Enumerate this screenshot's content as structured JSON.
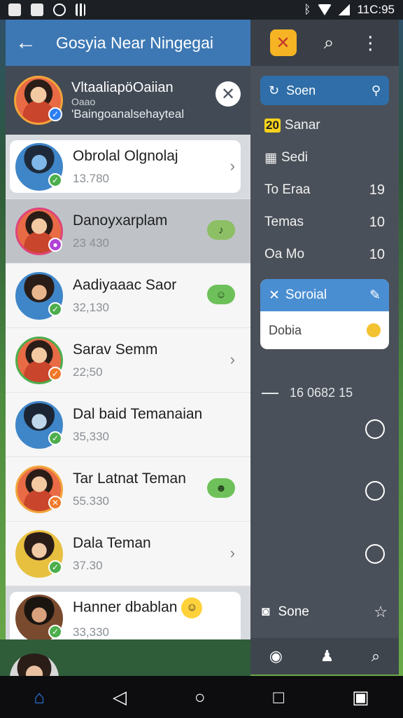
{
  "status_bar": {
    "time": "11C:95"
  },
  "app_bar": {
    "title": "Gosyia Near Ningegai"
  },
  "selected": {
    "name": "VltaaliapöOaiian",
    "line1": "Oaao",
    "line2": "'Baingoanalsehayteal"
  },
  "contacts": [
    {
      "name": "Obrolal Olgnolaj",
      "meta": "13.780"
    },
    {
      "name": "Danoyxarplam",
      "meta": "23 430"
    },
    {
      "name": "Aadiyaaac Saor",
      "meta": "32,130"
    },
    {
      "name": "Sarav Semm",
      "meta": "22;50"
    },
    {
      "name": "Dal baid Temanaian",
      "meta": "35,330"
    },
    {
      "name": "Tar Latnat Teman",
      "meta": "55.330"
    },
    {
      "name": "Dala Teman",
      "meta": "37.30"
    },
    {
      "name": "Hanner dbablan",
      "meta": "33,330"
    }
  ],
  "drawer": {
    "search_label": "Soen",
    "items": [
      {
        "tag": "20",
        "label": "Sanar",
        "num": ""
      },
      {
        "tag": "",
        "label": "Sedi",
        "num": ""
      },
      {
        "tag": "",
        "label": "To Eraa",
        "num": "19"
      },
      {
        "tag": "",
        "label": "Temas",
        "num": "10"
      },
      {
        "tag": "",
        "label": "Oa Mo",
        "num": "10"
      }
    ],
    "social_title": "Soroial",
    "social_body": "Dobia",
    "divider_text": "16 0682 15",
    "footer_label": "Sone"
  },
  "colors": {
    "appbar": "#3d78b4",
    "drawer": "#4a5059",
    "accent": "#2f6ea8"
  }
}
